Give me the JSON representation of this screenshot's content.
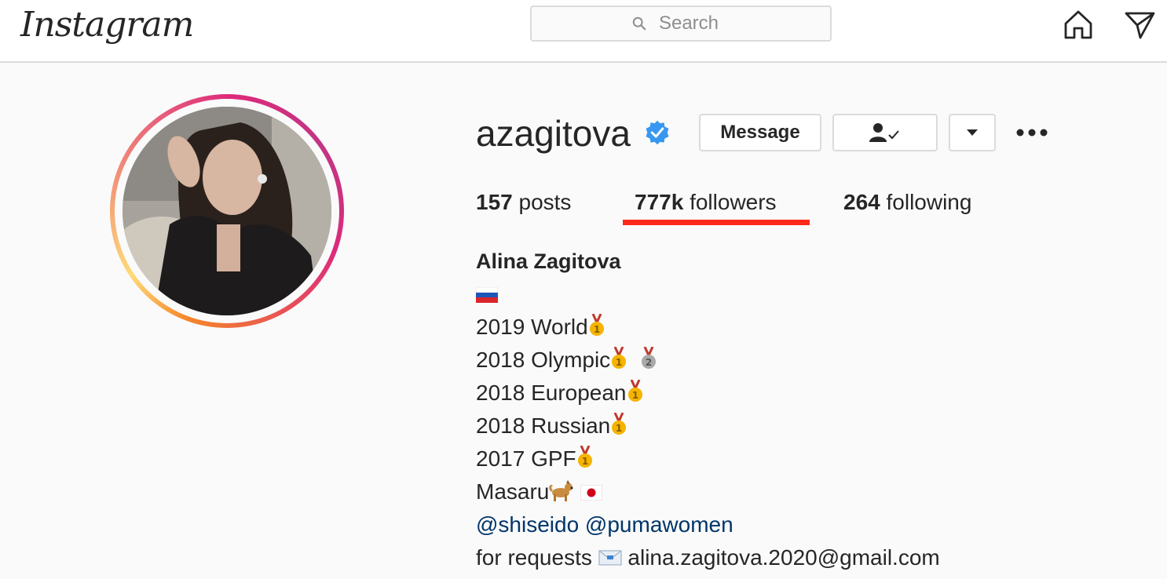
{
  "header": {
    "logo_text": "Instagram",
    "search": {
      "placeholder": "Search"
    },
    "icons": [
      "home-icon",
      "direct-message-icon"
    ]
  },
  "profile": {
    "username": "azagitova",
    "verified": true,
    "buttons": {
      "message": "Message",
      "following_icon": "person-check-icon",
      "dropdown_icon": "chevron-down-icon",
      "more_icon": "ellipsis-icon"
    },
    "stats": {
      "posts_count": "157",
      "posts_label": "posts",
      "followers_count": "777k",
      "followers_label": "followers",
      "following_count": "264",
      "following_label": "following"
    },
    "highlight_color": "#ff2a1a",
    "ring_colors": [
      "#f58529",
      "#dd2a7b",
      "#c13584"
    ],
    "bio": {
      "full_name": "Alina Zagitova",
      "flag_icon": "russia-flag-icon",
      "lines": [
        {
          "text": "2019 World",
          "icons": [
            "gold-medal-icon"
          ]
        },
        {
          "text": "2018 Olympic",
          "icons": [
            "gold-medal-icon",
            "silver-medal-icon"
          ]
        },
        {
          "text": "2018 European",
          "icons": [
            "gold-medal-icon"
          ]
        },
        {
          "text": "2018 Russian",
          "icons": [
            "gold-medal-icon"
          ]
        },
        {
          "text": "2017 GPF",
          "icons": [
            "gold-medal-icon"
          ]
        },
        {
          "text": "Masaru",
          "icons": [
            "dog-icon",
            "japan-flag-icon"
          ]
        }
      ],
      "tags": "@shiseido @pumawomen",
      "requests_label": "for requests",
      "requests_icon": "envelope-icon",
      "email": "alina.zagitova.2020@gmail.com"
    }
  }
}
